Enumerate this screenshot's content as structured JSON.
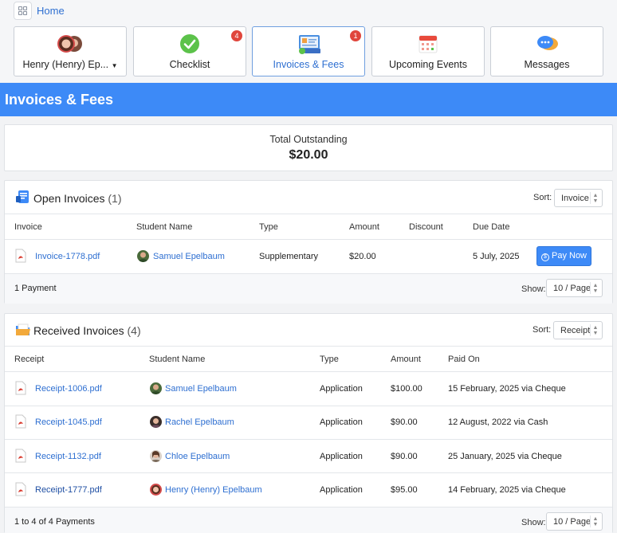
{
  "nav": {
    "home": "Home",
    "tiles": [
      {
        "label": "Henry (Henry) Ep...",
        "icon": "family-avatars-icon",
        "badge": ""
      },
      {
        "label": "Checklist",
        "icon": "checkmark-icon",
        "badge": "4"
      },
      {
        "label": "Invoices & Fees",
        "icon": "invoice-icon",
        "badge": "1"
      },
      {
        "label": "Upcoming Events",
        "icon": "calendar-icon",
        "badge": ""
      },
      {
        "label": "Messages",
        "icon": "chat-icon",
        "badge": ""
      }
    ]
  },
  "page_title": "Invoices & Fees",
  "total": {
    "label": "Total Outstanding",
    "amount": "$20.00"
  },
  "open_invoices": {
    "title": "Open Invoices",
    "count": "(1)",
    "sort_label": "Sort:",
    "sort_value": "Invoice",
    "columns": [
      "Invoice",
      "Student Name",
      "Type",
      "Amount",
      "Discount",
      "Due Date"
    ],
    "rows": [
      {
        "file": "Invoice-1778.pdf",
        "student": "Samuel Epelbaum",
        "type": "Supplementary",
        "amount": "$20.00",
        "discount": "",
        "due": "5 July, 2025",
        "action": "Pay Now"
      }
    ],
    "footer": "1 Payment",
    "show_label": "Show:",
    "show_value": "10 / Page"
  },
  "received_invoices": {
    "title": "Received Invoices",
    "count": "(4)",
    "sort_label": "Sort:",
    "sort_value": "Receipt",
    "columns": [
      "Receipt",
      "Student Name",
      "Type",
      "Amount",
      "Paid On"
    ],
    "rows": [
      {
        "file": "Receipt-1006.pdf",
        "student": "Samuel Epelbaum",
        "type": "Application",
        "amount": "$100.00",
        "paid": "15 February, 2025 via Cheque"
      },
      {
        "file": "Receipt-1045.pdf",
        "student": "Rachel Epelbaum",
        "type": "Application",
        "amount": "$90.00",
        "paid": "12 August, 2022 via Cash"
      },
      {
        "file": "Receipt-1132.pdf",
        "student": "Chloe Epelbaum",
        "type": "Application",
        "amount": "$90.00",
        "paid": "25 January, 2025 via Cheque"
      },
      {
        "file": "Receipt-1777.pdf",
        "student": "Henry (Henry) Epelbaum",
        "type": "Application",
        "amount": "$95.00",
        "paid": "14 February, 2025 via Cheque"
      }
    ],
    "footer": "1 to 4 of 4 Payments",
    "show_label": "Show:",
    "show_value": "10 / Page"
  },
  "colors": {
    "accent": "#3d8af7",
    "link": "#2e6fd1",
    "badge": "#e0463c"
  }
}
